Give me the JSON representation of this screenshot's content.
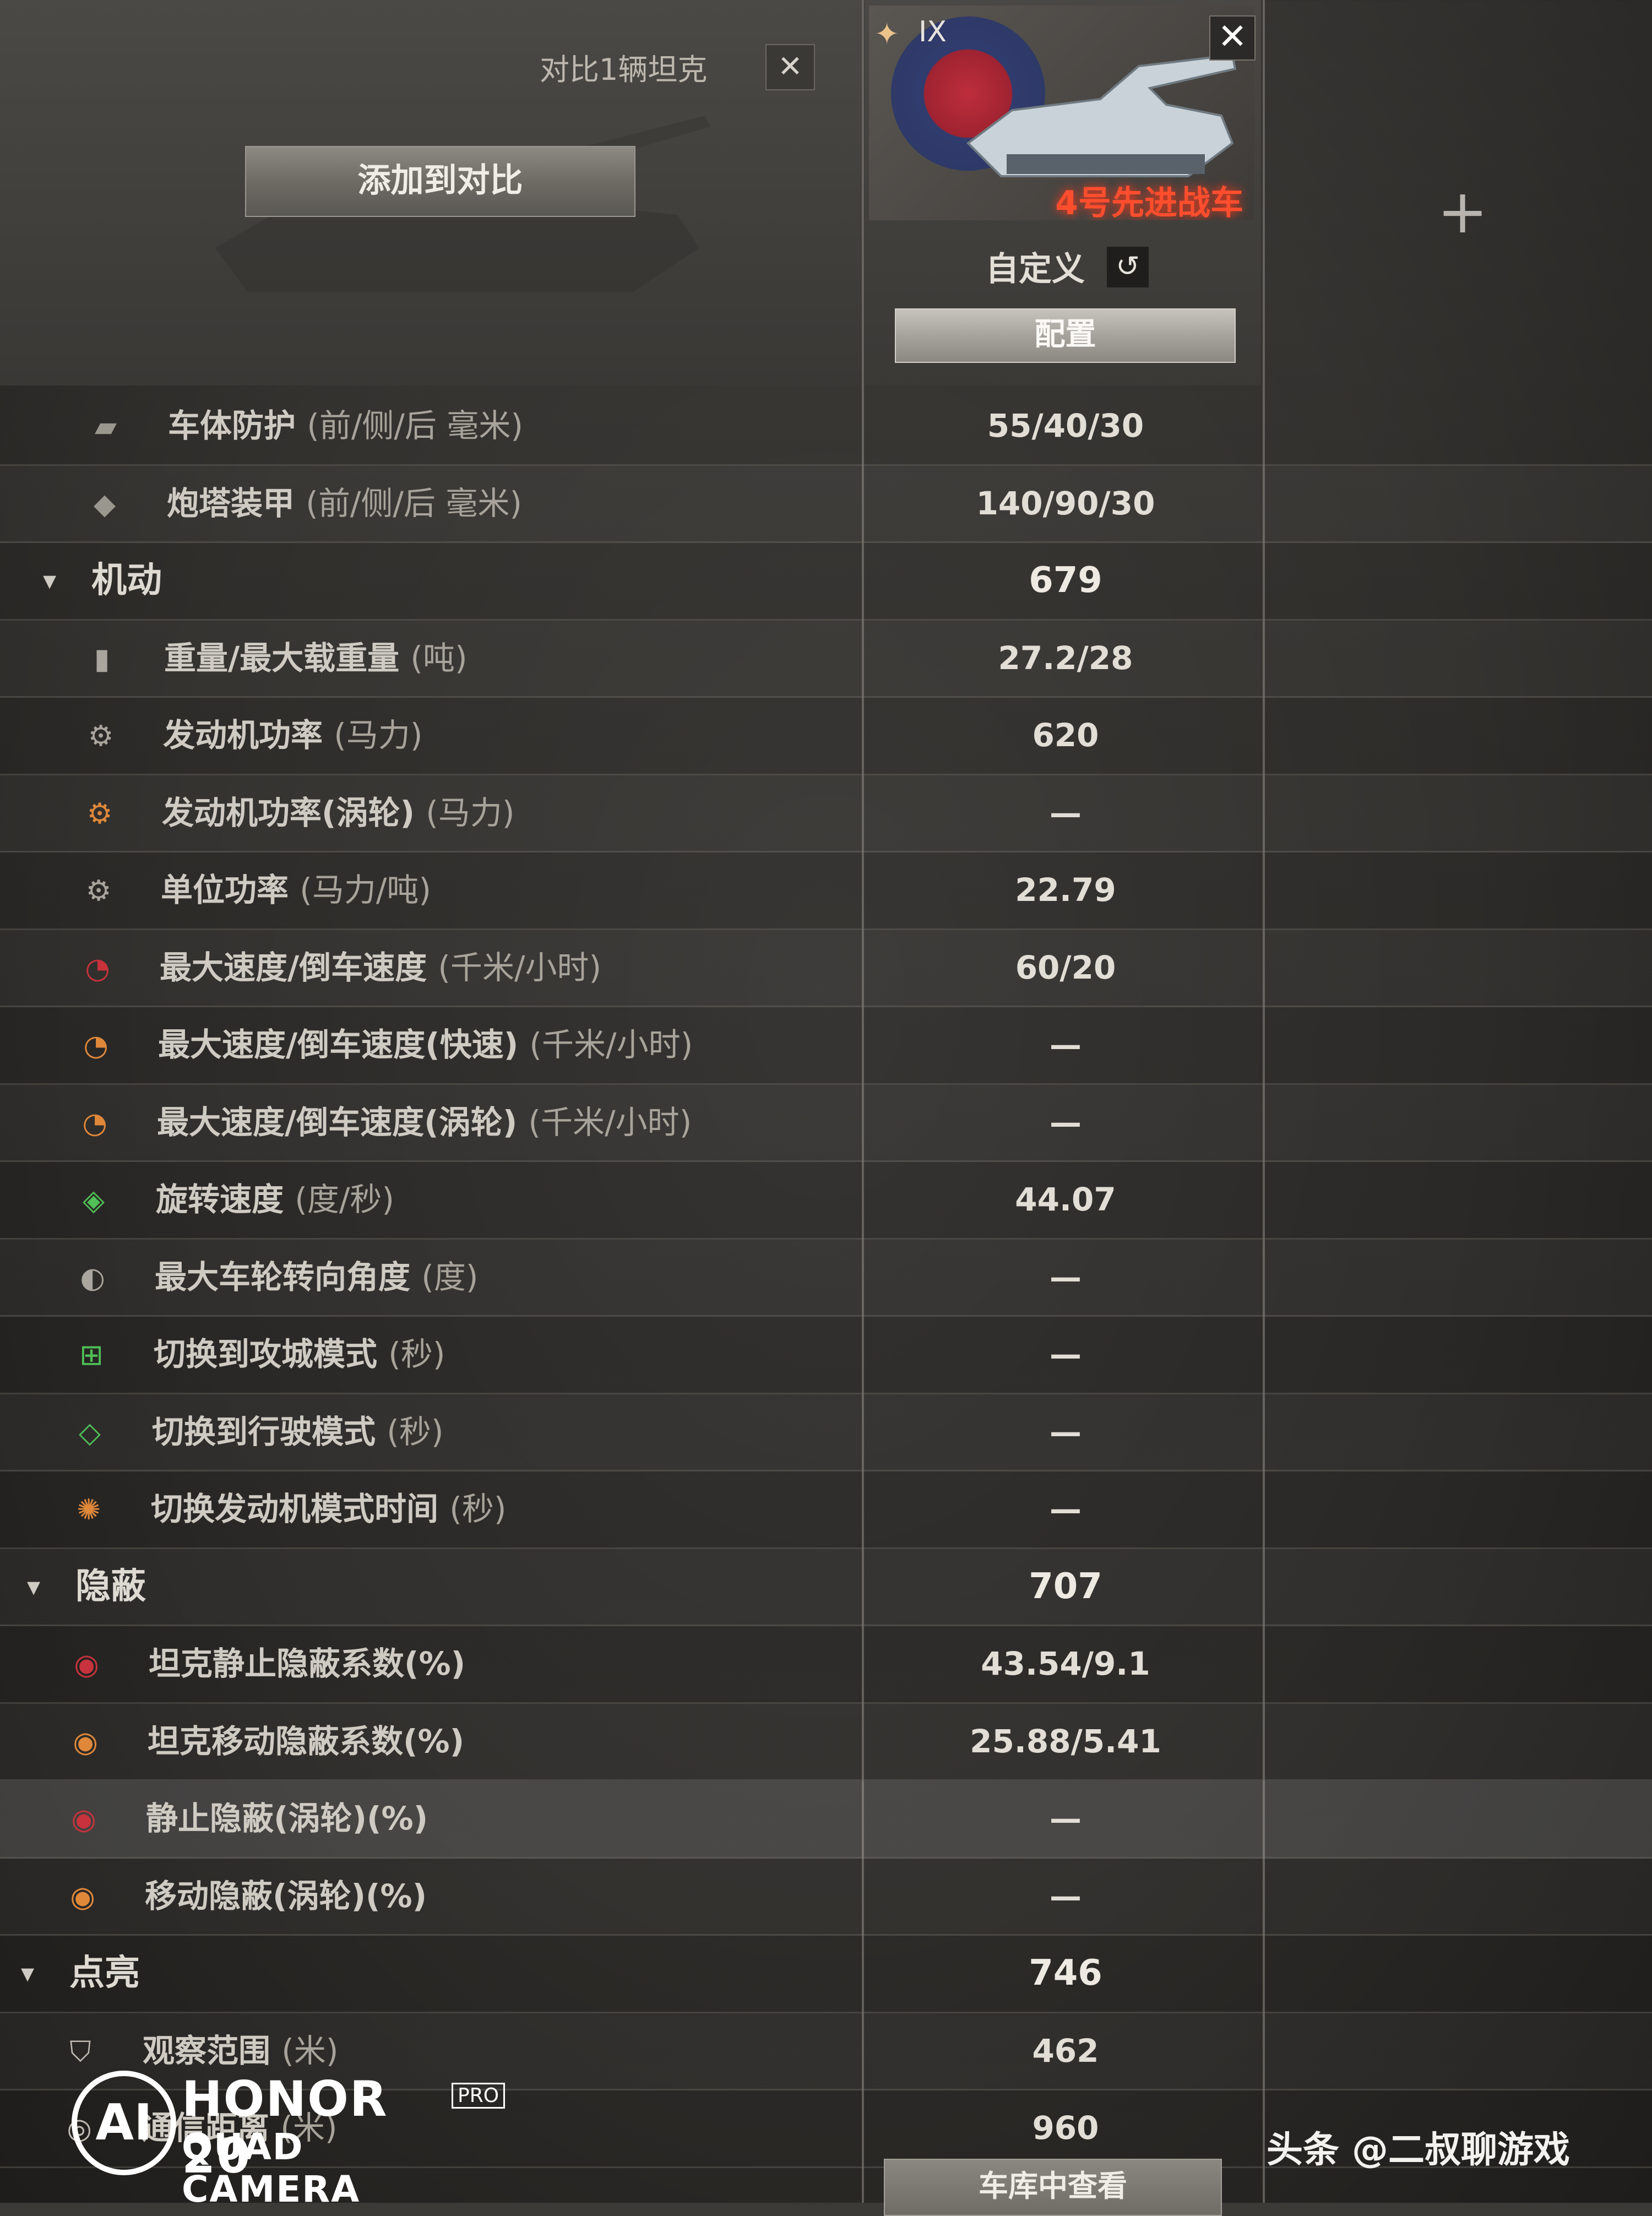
{
  "header": {
    "compare_title": "对比1辆坦克",
    "close_symbol": "✕",
    "add_button": "添加到对比",
    "add_slot_symbol": "+"
  },
  "tank_card": {
    "tier": "IX",
    "name": "4号先进战车",
    "custom_label": "自定义",
    "undo_symbol": "↺",
    "config_button": "配置",
    "close_symbol": "✕"
  },
  "rows": [
    {
      "type": "row",
      "icon": "hull-armor-icon",
      "glyph": "▰",
      "label": "车体防护",
      "unit": "(前/侧/后 毫米)",
      "value": "55/40/30"
    },
    {
      "type": "row",
      "icon": "turret-armor-icon",
      "glyph": "◆",
      "label": "炮塔装甲",
      "unit": "(前/侧/后 毫米)",
      "value": "140/90/30"
    },
    {
      "type": "section",
      "label": "机动",
      "value": "679"
    },
    {
      "type": "row",
      "icon": "weight-icon",
      "glyph": "▮",
      "label": "重量/最大载重量",
      "unit": "(吨)",
      "value": "27.2/28"
    },
    {
      "type": "row",
      "icon": "engine-power-icon",
      "glyph": "⚙",
      "label": "发动机功率",
      "unit": "(马力)",
      "value": "620"
    },
    {
      "type": "row",
      "icon": "engine-turbo-icon",
      "glyph": "⚙",
      "label": "发动机功率(涡轮)",
      "unit": "(马力)",
      "value": "—"
    },
    {
      "type": "row",
      "icon": "specific-power-icon",
      "glyph": "⚙",
      "label": "单位功率",
      "unit": "(马力/吨)",
      "value": "22.79"
    },
    {
      "type": "row",
      "icon": "speed-icon",
      "glyph": "◔",
      "label": "最大速度/倒车速度",
      "unit": "(千米/小时)",
      "value": "60/20"
    },
    {
      "type": "row",
      "icon": "speed-fast-icon",
      "glyph": "◔",
      "label": "最大速度/倒车速度(快速)",
      "unit": "(千米/小时)",
      "value": "—"
    },
    {
      "type": "row",
      "icon": "speed-turbo-icon",
      "glyph": "◔",
      "label": "最大速度/倒车速度(涡轮)",
      "unit": "(千米/小时)",
      "value": "—"
    },
    {
      "type": "row",
      "icon": "traverse-icon",
      "glyph": "◈",
      "label": "旋转速度",
      "unit": "(度/秒)",
      "value": "44.07"
    },
    {
      "type": "row",
      "icon": "wheel-angle-icon",
      "glyph": "◐",
      "label": "最大车轮转向角度",
      "unit": "(度)",
      "value": "—"
    },
    {
      "type": "row",
      "icon": "siege-mode-icon",
      "glyph": "⊞",
      "label": "切换到攻城模式",
      "unit": "(秒)",
      "value": "—"
    },
    {
      "type": "row",
      "icon": "travel-mode-icon",
      "glyph": "◇",
      "label": "切换到行驶模式",
      "unit": "(秒)",
      "value": "—"
    },
    {
      "type": "row",
      "icon": "engine-mode-icon",
      "glyph": "✺",
      "label": "切换发动机模式时间",
      "unit": "(秒)",
      "value": "—"
    },
    {
      "type": "section",
      "label": "隐蔽",
      "value": "707"
    },
    {
      "type": "row",
      "icon": "camo-stationary-icon",
      "glyph": "◉",
      "label": "坦克静止隐蔽系数(%)",
      "unit": "",
      "value": "43.54/9.1"
    },
    {
      "type": "row",
      "icon": "camo-moving-icon",
      "glyph": "◉",
      "label": "坦克移动隐蔽系数(%)",
      "unit": "",
      "value": "25.88/5.41"
    },
    {
      "type": "row",
      "icon": "camo-stationary-turbo-icon",
      "glyph": "◉",
      "label": "静止隐蔽(涡轮)(%)",
      "unit": "",
      "value": "—",
      "highlight": true
    },
    {
      "type": "row",
      "icon": "camo-moving-turbo-icon",
      "glyph": "◉",
      "label": "移动隐蔽(涡轮)(%)",
      "unit": "",
      "value": "—"
    },
    {
      "type": "section",
      "label": "点亮",
      "value": "746"
    },
    {
      "type": "row",
      "icon": "view-range-icon",
      "glyph": "⛉",
      "label": "观察范围",
      "unit": "(米)",
      "value": "462"
    },
    {
      "type": "row",
      "icon": "signal-range-icon",
      "glyph": "◎",
      "label": "通信距离",
      "unit": "(米)",
      "value": "960"
    }
  ],
  "watermark": {
    "ai": "AI",
    "brand": "HONOR 20",
    "pro": "PRO",
    "sub": "QUAD CAMERA",
    "source": "头条 @二叔聊游戏"
  },
  "garage_button": "车库中查看",
  "colors": {
    "accent_red": "#ff4e2e",
    "icon_red": "#c8323c",
    "icon_green": "#4fbf56",
    "icon_orange": "#e0883a"
  }
}
